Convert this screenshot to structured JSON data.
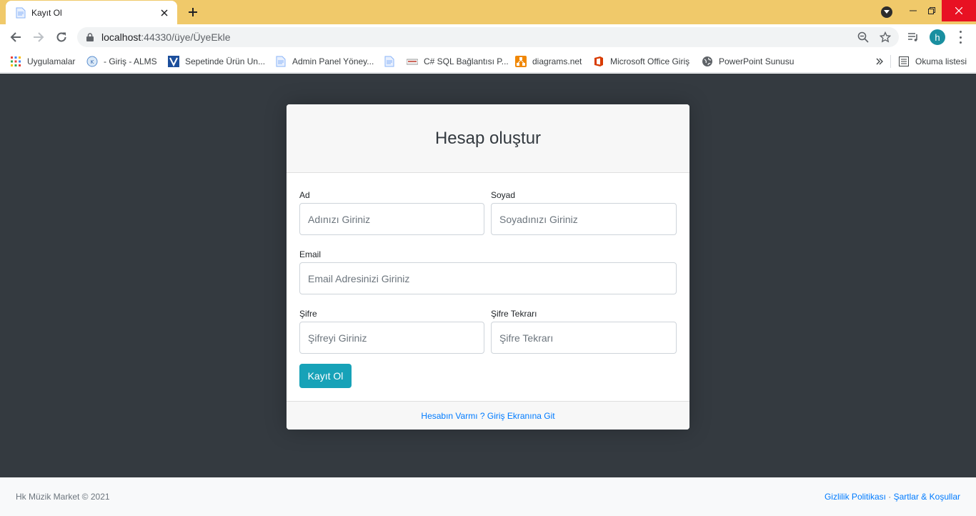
{
  "browser": {
    "tab_title": "Kayıt Ol",
    "url_host": "localhost",
    "url_rest": ":44330/üye/ÜyeEkle",
    "avatar_letter": "h",
    "accent": "#f0c96a"
  },
  "bookmarks": [
    {
      "label": "Uygulamalar",
      "icon": "apps-grid-icon"
    },
    {
      "label": "- Giriş - ALMS",
      "icon": "alms-icon"
    },
    {
      "label": "Sepetinde Ürün Un...",
      "icon": "v-logo-icon"
    },
    {
      "label": "Admin Panel Yöney...",
      "icon": "page-icon"
    },
    {
      "label": "",
      "icon": "page-icon"
    },
    {
      "label": "C# SQL Bağlantısı P...",
      "icon": "keyboard-icon"
    },
    {
      "label": "diagrams.net",
      "icon": "diagrams-icon"
    },
    {
      "label": "Microsoft Office Giriş",
      "icon": "office-icon"
    },
    {
      "label": "PowerPoint Sunusu",
      "icon": "globe-icon"
    }
  ],
  "reading_list": "Okuma listesi",
  "form": {
    "heading": "Hesap oluştur",
    "ad_label": "Ad",
    "ad_placeholder": "Adınızı Giriniz",
    "soyad_label": "Soyad",
    "soyad_placeholder": "Soyadınızı Giriniz",
    "email_label": "Email",
    "email_placeholder": "Email Adresinizi Giriniz",
    "sifre_label": "Şifre",
    "sifre_placeholder": "Şifreyi Giriniz",
    "sifre_tekrar_label": "Şifre Tekrarı",
    "sifre_tekrar_placeholder": "Şifre Tekrarı",
    "submit_label": "Kayıt Ol",
    "login_link": "Hesabın Varmı ? Giriş Ekranına Git",
    "button_color": "#17a2b8"
  },
  "footer": {
    "copyright": "Hk Müzik Market © 2021",
    "privacy": "Gizlilik Politikası",
    "separator": " · ",
    "terms": "Şartlar & Koşullar"
  }
}
